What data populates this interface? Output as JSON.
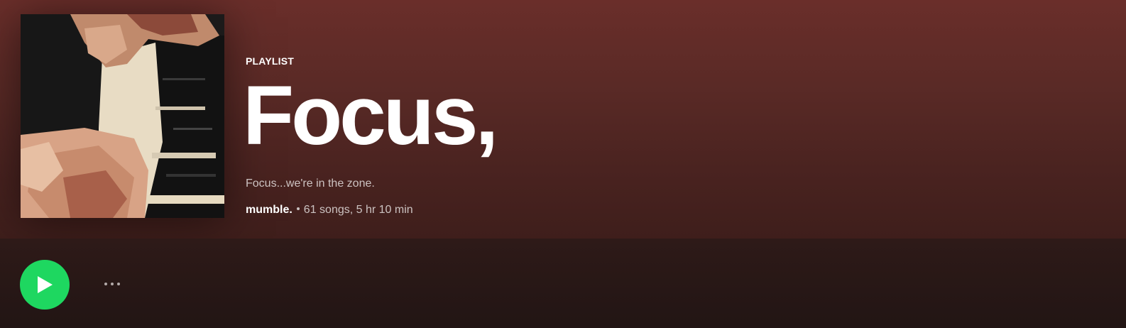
{
  "playlist": {
    "type_label": "PLAYLIST",
    "title": "Focus,",
    "description": "Focus...we're in the zone.",
    "owner": "mumble.",
    "stats": "61 songs, 5 hr 10 min"
  },
  "actions": {
    "play_icon": "play-icon",
    "more_icon": "more-options-icon"
  },
  "colors": {
    "header_gradient_top": "#6a2e2a",
    "header_gradient_bottom": "#3e1e1b",
    "play_button": "#1ed760",
    "text_primary": "#ffffff"
  }
}
